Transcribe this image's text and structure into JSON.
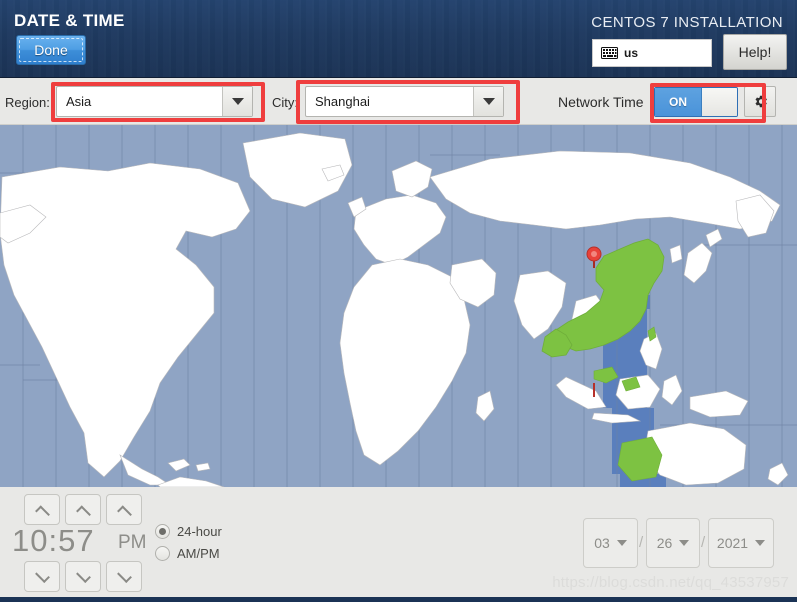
{
  "header": {
    "title": "DATE & TIME",
    "done_label": "Done",
    "install_title": "CENTOS 7 INSTALLATION",
    "keyboard_layout": "us",
    "keyboard_icon": "keyboard-icon",
    "help_label": "Help!"
  },
  "toolbar": {
    "region_label": "Region:",
    "region_value": "Asia",
    "city_label": "City:",
    "city_value": "Shanghai",
    "network_time_label": "Network Time",
    "network_time_state": "ON",
    "gear_icon": "gear-icon"
  },
  "map": {
    "selected_city_marker": "map-pin-icon",
    "highlighted_country": "China",
    "colors": {
      "water": "#8fa4c4",
      "land": "#ffffff",
      "highlight": "#7dc242",
      "selected_zone": "#5a7fbd",
      "marker": "#e8413a"
    }
  },
  "time": {
    "display": "10:57",
    "meridiem": "PM",
    "hours": "10",
    "minutes": "57",
    "format_options": [
      {
        "label": "24-hour",
        "selected": true
      },
      {
        "label": "AM/PM",
        "selected": false
      }
    ],
    "up_icon": "chevron-up-icon",
    "down_icon": "chevron-down-icon"
  },
  "date": {
    "month": "03",
    "day": "26",
    "year": "2021",
    "separator": "/"
  },
  "watermark": "https://blog.csdn.net/qq_43537957",
  "annotations": {
    "color": "#ef3e3e",
    "boxes": [
      "region-combo",
      "city-combo",
      "network-time-toggle"
    ]
  }
}
